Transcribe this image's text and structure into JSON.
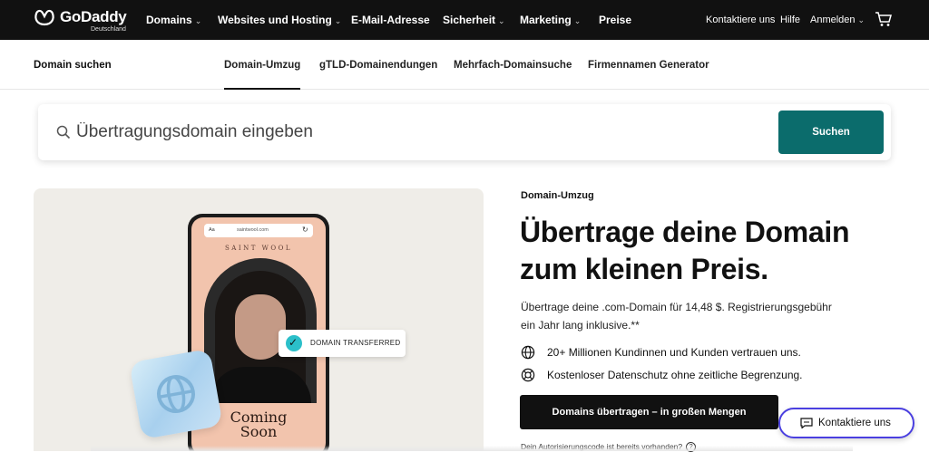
{
  "brand": {
    "name": "GoDaddy",
    "region": "Deutschland"
  },
  "topnav": {
    "items": [
      {
        "label": "Domains",
        "dropdown": true
      },
      {
        "label": "Websites und Hosting",
        "dropdown": true
      },
      {
        "label": "E-Mail-Adresse",
        "dropdown": false
      },
      {
        "label": "Sicherheit",
        "dropdown": true
      },
      {
        "label": "Marketing",
        "dropdown": true
      },
      {
        "label": "Preise",
        "dropdown": false
      }
    ],
    "contact": "Kontaktiere uns",
    "help": "Hilfe",
    "login": "Anmelden",
    "chevron": "⌄"
  },
  "subnav": {
    "title": "Domain suchen",
    "links": [
      "Domain-Umzug",
      "gTLD-Domainendungen",
      "Mehrfach-Domainsuche",
      "Firmennamen Generator"
    ],
    "active_index": 0
  },
  "search": {
    "placeholder": "Übertragungsdomain eingeben",
    "button": "Suchen"
  },
  "hero_image": {
    "url_aa": "Aa",
    "url": "saintwool.com",
    "reload": "↻",
    "brand": "SAINT WOOL",
    "coming_soon_line1": "Coming",
    "coming_soon_line2": "Soon",
    "badge": "DOMAIN TRANSFERRED",
    "check": "✓"
  },
  "hero": {
    "eyebrow": "Domain-Umzug",
    "headline_line1": "Übertrage deine Domain",
    "headline_line2": "zum kleinen Preis.",
    "lead_line1": "Übertrage deine .com-Domain für 14,48 $. Registrierungsgebühr",
    "lead_line2": "ein Jahr lang inklusive.**",
    "bullets": [
      {
        "icon": "globe-icon",
        "text": "20+ Millionen Kundinnen und Kunden vertrauen uns."
      },
      {
        "icon": "lifebuoy-icon",
        "text": "Kostenloser Datenschutz ohne zeitliche Begrenzung."
      }
    ],
    "cta": "Domains übertragen – in großen Mengen",
    "auth_note": "Dein Autorisierungscode ist bereits vorhanden?",
    "help_glyph": "?"
  },
  "chat": {
    "label": "Kontaktiere uns"
  },
  "colors": {
    "topbar": "#111111",
    "search_button": "#0b6c6c",
    "chat_border": "#4a3fe0",
    "check": "#2bbfc9"
  }
}
